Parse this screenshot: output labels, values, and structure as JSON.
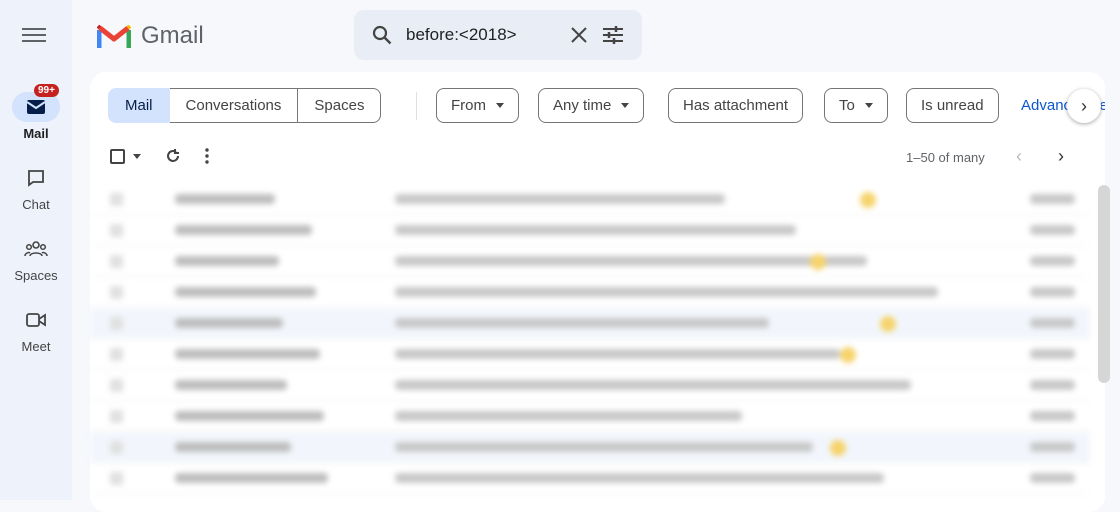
{
  "app": {
    "name": "Gmail"
  },
  "rail": {
    "items": [
      {
        "label": "Mail",
        "icon": "mail-icon",
        "badge": "99+",
        "active": true
      },
      {
        "label": "Chat",
        "icon": "chat-icon"
      },
      {
        "label": "Spaces",
        "icon": "spaces-icon"
      },
      {
        "label": "Meet",
        "icon": "video-icon"
      }
    ]
  },
  "search": {
    "value": "before:<2018>"
  },
  "filters": {
    "segments": [
      "Mail",
      "Conversations",
      "Spaces"
    ],
    "chips": [
      {
        "label": "From",
        "dropdown": true
      },
      {
        "label": "Any time",
        "dropdown": true
      },
      {
        "label": "Has attachment",
        "dropdown": false
      },
      {
        "label": "To",
        "dropdown": true
      },
      {
        "label": "Is unread",
        "dropdown": false
      }
    ],
    "advanced": "Advanced search"
  },
  "toolbar": {
    "pager": "1–50 of many"
  },
  "colors": {
    "accent": "#0b57d0",
    "selected": "#d3e3fd",
    "badge": "#c5221f"
  },
  "list": {
    "note": "",
    "rows": [
      {
        "selected": false,
        "star": true
      },
      {
        "selected": false,
        "star": false
      },
      {
        "selected": false,
        "star": true
      },
      {
        "selected": false,
        "star": false
      },
      {
        "selected": true,
        "star": true
      },
      {
        "selected": false,
        "star": true
      },
      {
        "selected": false,
        "star": false
      },
      {
        "selected": false,
        "star": false
      },
      {
        "selected": true,
        "star": true
      },
      {
        "selected": false,
        "star": false
      }
    ]
  }
}
